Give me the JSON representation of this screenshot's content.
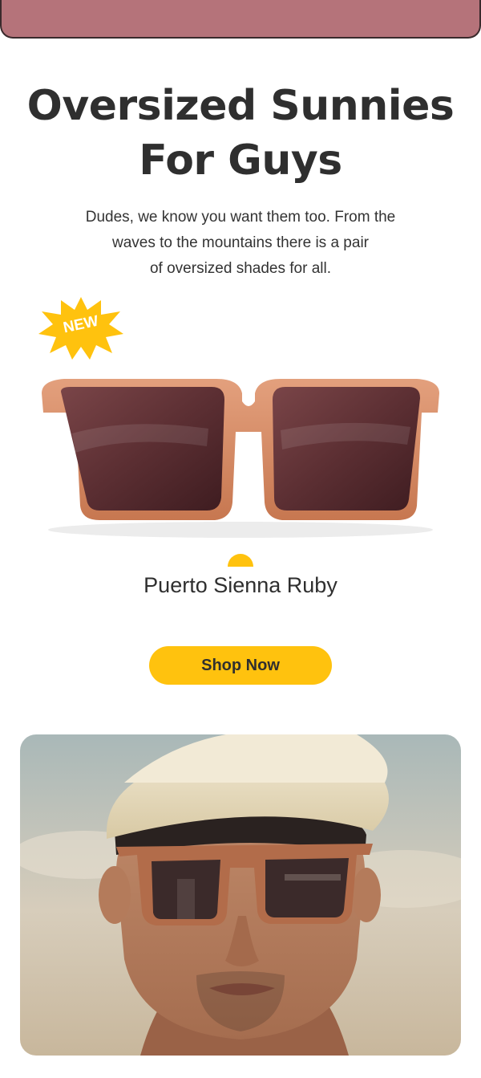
{
  "header": {
    "banner_color": "#b5737a"
  },
  "hero": {
    "headline_line1": "Oversized Sunnies",
    "headline_line2": "For Guys",
    "subcopy_line1": "Dudes, we know you want them too. From the",
    "subcopy_line2": "waves to the mountains there is a pair",
    "subcopy_line3": "of oversized shades for all."
  },
  "product": {
    "badge": "NEW",
    "name": "Puerto Sienna Ruby",
    "frame_color": "#d48862",
    "lens_color": "#5a2e30"
  },
  "cta": {
    "label": "Shop Now",
    "color": "#ffc20e"
  },
  "icons": [
    "sunglasses-image",
    "sun-icon",
    "starburst-badge-icon",
    "model-photo"
  ]
}
